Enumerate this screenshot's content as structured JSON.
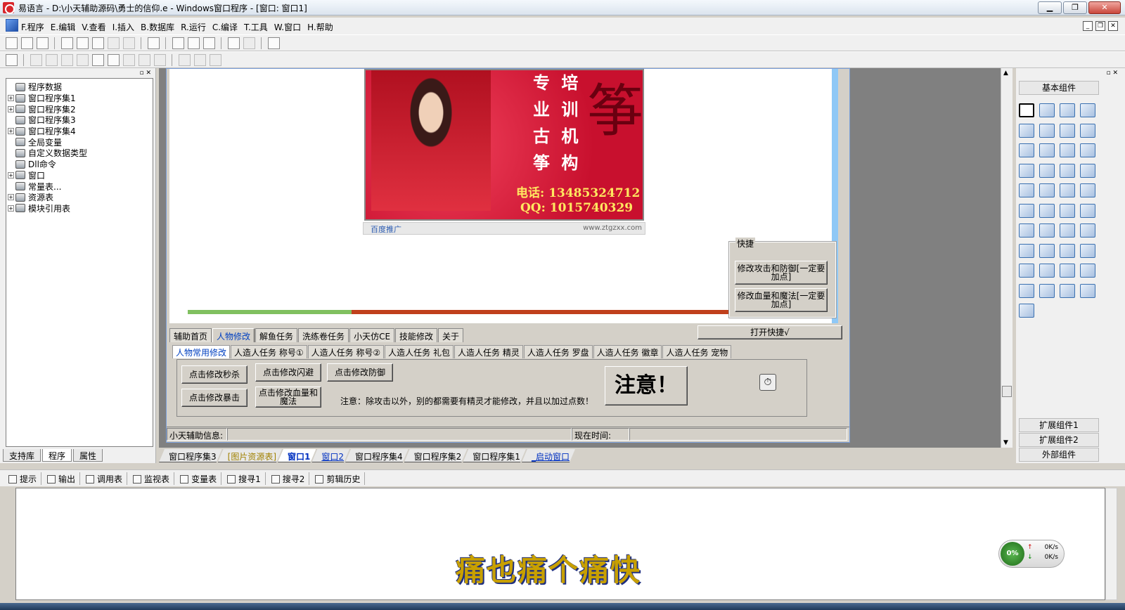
{
  "window": {
    "title": "易语言 - D:\\小天辅助源码\\勇士的信仰.e - Windows窗口程序 - [窗口: 窗口1]",
    "min_label": "▁",
    "max_label": "❐",
    "close_label": "✕"
  },
  "menu": {
    "items": [
      "F.程序",
      "E.编辑",
      "V.查看",
      "I.插入",
      "B.数据库",
      "R.运行",
      "C.编译",
      "T.工具",
      "W.窗口",
      "H.帮助"
    ]
  },
  "tree": {
    "items": [
      {
        "label": "程序数据",
        "expand": ""
      },
      {
        "label": "窗口程序集1",
        "expand": "+"
      },
      {
        "label": "窗口程序集2",
        "expand": "+"
      },
      {
        "label": "窗口程序集3",
        "expand": ""
      },
      {
        "label": "窗口程序集4",
        "expand": "+"
      },
      {
        "label": "全局变量",
        "expand": ""
      },
      {
        "label": "自定义数据类型",
        "expand": ""
      },
      {
        "label": "Dll命令",
        "expand": ""
      },
      {
        "label": "窗口",
        "expand": "+"
      },
      {
        "label": "常量表...",
        "expand": ""
      },
      {
        "label": "资源表",
        "expand": "+"
      },
      {
        "label": "模块引用表",
        "expand": "+"
      }
    ],
    "bottom_tabs": [
      "支持库",
      "程序",
      "属性"
    ]
  },
  "ad": {
    "line1": "专 培",
    "line2": "业 训",
    "line3": "古 机",
    "line4": "筝 构",
    "brand_char": "筝",
    "phone": "电话: 13485324712",
    "qq": "QQ: 1015740329",
    "footer_left": "百度推广",
    "footer_right": "www.ztgzxx.com"
  },
  "progress": {
    "value_fraction": 0.3
  },
  "quick": {
    "legend": "快捷",
    "btn1": "修改攻击和防御[一定要加点]",
    "btn2": "修改血量和魔法[一定要加点]",
    "open_label": "打开快捷√"
  },
  "tabs": {
    "main": [
      "辅助首页",
      "人物修改",
      "解鱼任务",
      "洗练卷任务",
      "小天仿CE",
      "技能修改",
      "关于"
    ],
    "sub": [
      "人物常用修改",
      "人造人任务 称号①",
      "人造人任务 称号②",
      "人造人任务 礼包",
      "人造人任务 精灵",
      "人造人任务 罗盘",
      "人造人任务 徽章",
      "人造人任务 宠物"
    ]
  },
  "panel": {
    "btn_kill": "点击修改秒杀",
    "btn_dodge": "点击修改闪避",
    "btn_defense": "点击修改防御",
    "btn_crit": "点击修改暴击",
    "btn_hpmp": "点击修改血量和魔法",
    "notice": "注意：除攻击以外，别的都需要有精灵才能修改，并且以加过点数！",
    "big_notice": "注意！",
    "timer_icon": "⏱"
  },
  "status": {
    "info_label": "小天辅助信息:",
    "time_label": "现在时间:"
  },
  "doc_tabs": [
    "窗口程序集3",
    "[图片资源表]",
    "窗口1",
    "窗口2",
    "窗口程序集4",
    "窗口程序集2",
    "窗口程序集1",
    "_启动窗口"
  ],
  "components": {
    "basic": "基本组件",
    "ext1": "扩展组件1",
    "ext2": "扩展组件2",
    "external": "外部组件"
  },
  "bottom": {
    "tabs": [
      "提示",
      "输出",
      "调用表",
      "监视表",
      "变量表",
      "搜寻1",
      "搜寻2",
      "剪辑历史"
    ]
  },
  "overlay": {
    "slogan": "痛也痛个痛快",
    "net_percent": "0%",
    "net_up": "0K/s",
    "net_down": "0K/s"
  }
}
